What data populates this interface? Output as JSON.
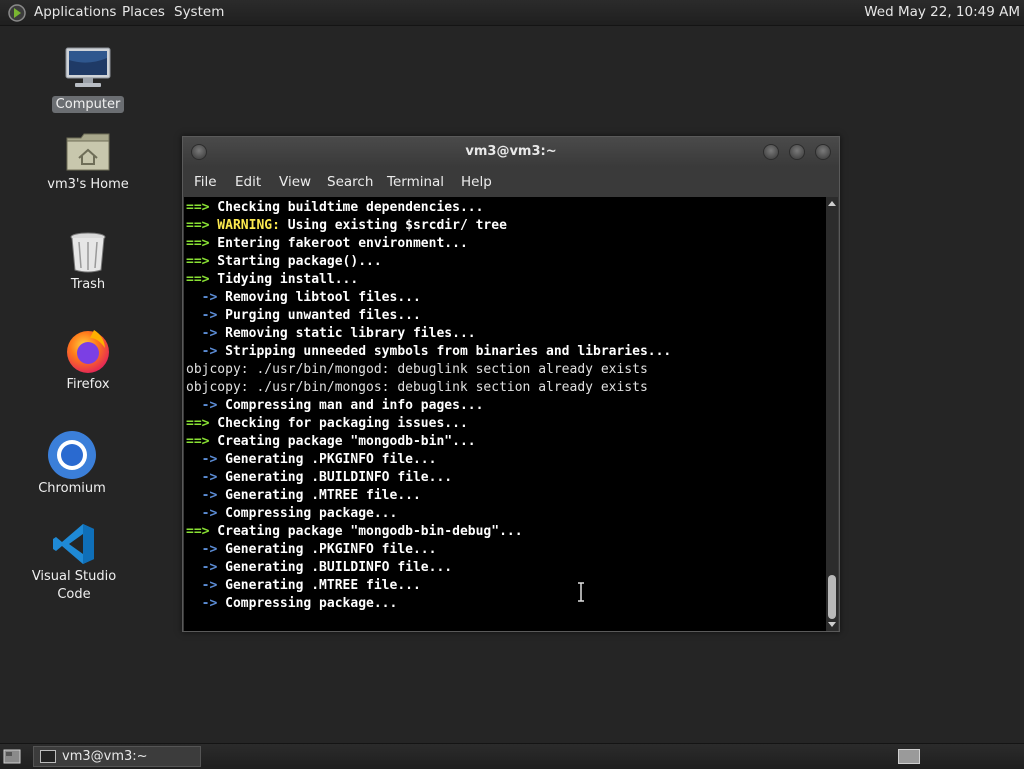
{
  "top_panel": {
    "menus": [
      "Applications",
      "Places",
      "System"
    ],
    "clock": "Wed May 22, 10:49 AM"
  },
  "desktop_icons": [
    {
      "label": "Computer",
      "icon": "computer-icon"
    },
    {
      "label": "vm3's Home",
      "icon": "home-folder-icon"
    },
    {
      "label": "Trash",
      "icon": "trash-icon"
    },
    {
      "label": "Firefox",
      "icon": "firefox-icon"
    },
    {
      "label": "Chromium",
      "icon": "chromium-icon"
    },
    {
      "label": "Visual Studio Code",
      "icon": "vscode-icon"
    }
  ],
  "terminal": {
    "title": "vm3@vm3:~",
    "menu": [
      "File",
      "Edit",
      "View",
      "Search",
      "Terminal",
      "Help"
    ],
    "lines": [
      {
        "type": "arrow",
        "prefix": "==>",
        "text": " Checking buildtime dependencies..."
      },
      {
        "type": "warning",
        "prefix": "==>",
        "warn": " WARNING:",
        "text": " Using existing $srcdir/ tree"
      },
      {
        "type": "arrow",
        "prefix": "==>",
        "text": " Entering fakeroot environment..."
      },
      {
        "type": "arrow",
        "prefix": "==>",
        "text": " Starting package()..."
      },
      {
        "type": "arrow",
        "prefix": "==>",
        "text": " Tidying install..."
      },
      {
        "type": "sub",
        "prefix": "  ->",
        "text": " Removing libtool files..."
      },
      {
        "type": "sub",
        "prefix": "  ->",
        "text": " Purging unwanted files..."
      },
      {
        "type": "sub",
        "prefix": "  ->",
        "text": " Removing static library files..."
      },
      {
        "type": "sub",
        "prefix": "  ->",
        "text": " Stripping unneeded symbols from binaries and libraries..."
      },
      {
        "type": "plain",
        "text": "objcopy: ./usr/bin/mongod: debuglink section already exists"
      },
      {
        "type": "plain",
        "text": "objcopy: ./usr/bin/mongos: debuglink section already exists"
      },
      {
        "type": "sub",
        "prefix": "  ->",
        "text": " Compressing man and info pages..."
      },
      {
        "type": "arrow",
        "prefix": "==>",
        "text": " Checking for packaging issues..."
      },
      {
        "type": "arrow",
        "prefix": "==>",
        "text": " Creating package \"mongodb-bin\"..."
      },
      {
        "type": "sub",
        "prefix": "  ->",
        "text": " Generating .PKGINFO file..."
      },
      {
        "type": "sub",
        "prefix": "  ->",
        "text": " Generating .BUILDINFO file..."
      },
      {
        "type": "sub",
        "prefix": "  ->",
        "text": " Generating .MTREE file..."
      },
      {
        "type": "sub",
        "prefix": "  ->",
        "text": " Compressing package..."
      },
      {
        "type": "arrow",
        "prefix": "==>",
        "text": " Creating package \"mongodb-bin-debug\"..."
      },
      {
        "type": "sub",
        "prefix": "  ->",
        "text": " Generating .PKGINFO file..."
      },
      {
        "type": "sub",
        "prefix": "  ->",
        "text": " Generating .BUILDINFO file..."
      },
      {
        "type": "sub",
        "prefix": "  ->",
        "text": " Generating .MTREE file..."
      },
      {
        "type": "sub",
        "prefix": "  ->",
        "text": " Compressing package..."
      }
    ]
  },
  "taskbar": {
    "task_label": "vm3@vm3:~"
  },
  "colors": {
    "arrow": "#8ae234",
    "warning": "#fce94f",
    "sub_arrow": "#5c8dd6",
    "terminal_bg": "#000000",
    "desktop_bg": "#252525"
  }
}
